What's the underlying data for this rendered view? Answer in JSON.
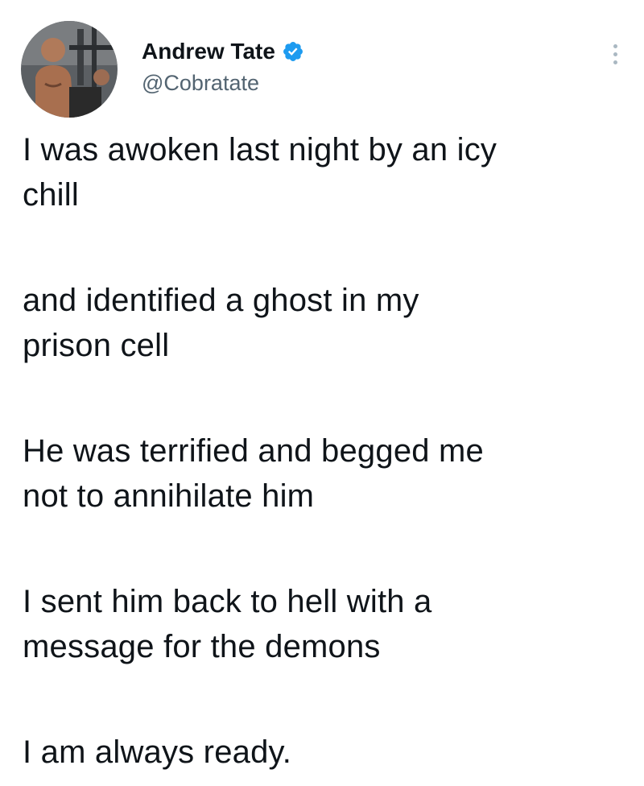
{
  "author": {
    "display_name": "Andrew Tate",
    "handle": "@Cobratate",
    "verified": true,
    "avatar_icon": "profile-photo-gym"
  },
  "tweet": {
    "paragraphs": [
      "I was awoken last night by an icy\nchill",
      "and identified a ghost in my\nprison cell",
      "He was terrified and begged me\nnot to annihilate him",
      "I sent him back to hell with a\nmessage for the demons",
      "I am always ready."
    ]
  },
  "colors": {
    "text": "#0f1419",
    "secondary_text": "#536471",
    "verified_badge": "#1d9bf0",
    "more_dots": "#aab8c2"
  }
}
